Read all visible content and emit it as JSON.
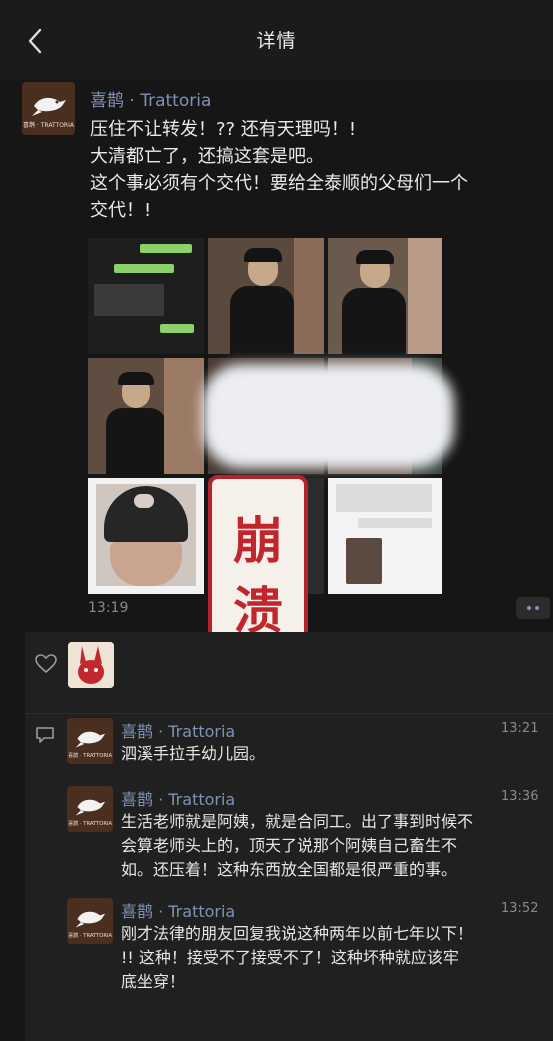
{
  "header": {
    "title": "详情"
  },
  "post": {
    "author": "喜鹊 · Trattoria",
    "avatar_label": "喜鹊 · TRATTORIA",
    "text": "压住不让转发！?? 还有天理吗！!\n大清都亡了，还搞这套是吧。\n这个事必须有个交代！要给全泰顺的父母们一个\n交代！!",
    "time": "13:19",
    "sticker": {
      "line1": "崩",
      "line2": "溃"
    }
  },
  "colors": {
    "background": "#161616",
    "name_link": "#7e92b5",
    "panel": "#202020"
  },
  "icons": {
    "back": "chevron-left-icon",
    "like": "heart-outline-icon",
    "comment": "comment-bubble-icon",
    "more": "more-dots-icon"
  },
  "comments": [
    {
      "author": "喜鹊 · Trattoria",
      "time": "13:21",
      "text": "泗溪手拉手幼儿园。"
    },
    {
      "author": "喜鹊 · Trattoria",
      "time": "13:36",
      "text": "生活老师就是阿姨，就是合同工。出了事到时候不\n会算老师头上的，顶天了说那个阿姨自己畜生不\n如。还压着！这种东西放全国都是很严重的事。"
    },
    {
      "author": "喜鹊 · Trattoria",
      "time": "13:52",
      "text": "刚才法律的朋友回复我说这种两年以前七年以下！\n!! 这种！接受不了接受不了！这种坏种就应该牢\n底坐穿！"
    }
  ]
}
